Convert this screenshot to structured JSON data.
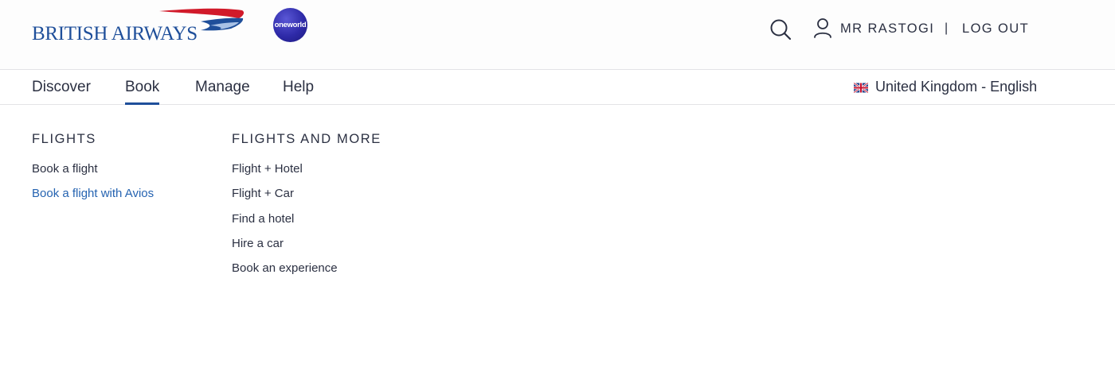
{
  "header": {
    "brand": "BRITISH AIRWAYS",
    "alliance": "oneworld",
    "search_icon": "search-icon",
    "user_icon": "user-icon",
    "user_name": "MR RASTOGI",
    "separator": "|",
    "logout_label": "LOG OUT"
  },
  "nav": {
    "items": [
      {
        "label": "Discover",
        "active": false
      },
      {
        "label": "Book",
        "active": true
      },
      {
        "label": "Manage",
        "active": false
      },
      {
        "label": "Help",
        "active": false
      }
    ],
    "locale": {
      "flag_icon": "uk-flag-icon",
      "label": "United Kingdom - English"
    }
  },
  "menu": {
    "columns": [
      {
        "heading": "FLIGHTS",
        "links": [
          "Book a flight",
          "Book a flight with Avios"
        ]
      },
      {
        "heading": "FLIGHTS AND MORE",
        "links": [
          "Flight + Hotel",
          "Flight + Car",
          "Find a hotel",
          "Hire a car",
          "Book an experience"
        ]
      }
    ]
  },
  "colors": {
    "brand_blue": "#1f4f9a",
    "speedmarque_red": "#d11a2a",
    "link_blue": "#2563b1",
    "text": "#2b3042"
  }
}
